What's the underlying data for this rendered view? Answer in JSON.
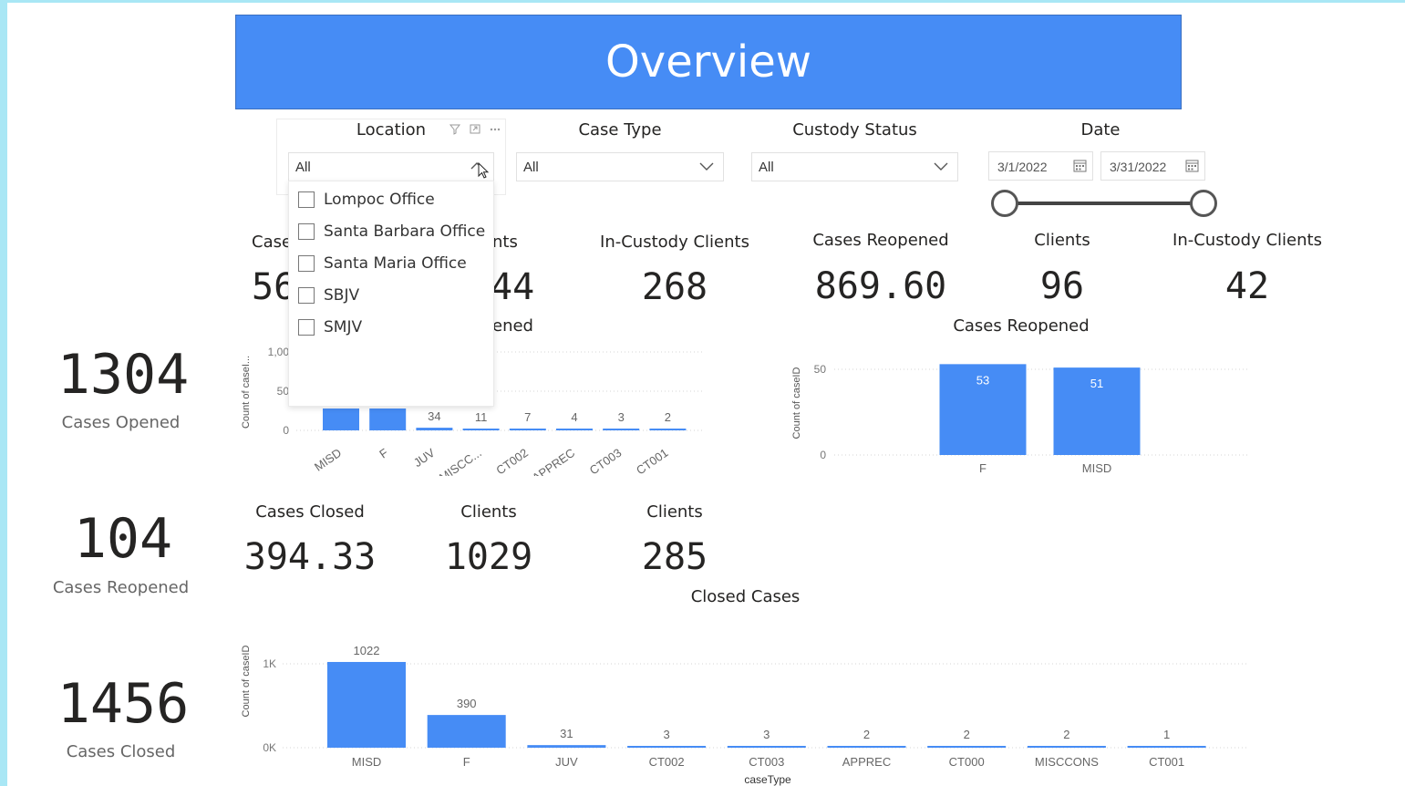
{
  "header": {
    "title": "Overview"
  },
  "slicers": {
    "location": {
      "title": "Location",
      "value": "All"
    },
    "case_type": {
      "title": "Case Type",
      "value": "All"
    },
    "custody_status": {
      "title": "Custody Status",
      "value": "All"
    },
    "date": {
      "title": "Date",
      "start": "3/1/2022",
      "end": "3/31/2022"
    }
  },
  "location_options": [
    "Lompoc Office",
    "Santa Barbara Office",
    "Santa Maria Office",
    "SBJV",
    "SMJV"
  ],
  "left_kpis": [
    {
      "value": "1304",
      "label": "Cases Opened"
    },
    {
      "value": "104",
      "label": "Cases Reopened"
    },
    {
      "value": "1456",
      "label": "Cases Closed"
    }
  ],
  "row1_kpis": {
    "cases_label_partial": "Case",
    "cases_value_partial": "56",
    "clients_label_partial": "nts",
    "clients_value_partial": "44",
    "incustody_label": "In-Custody Clients",
    "incustody_value": "268"
  },
  "row1_right_kpis": [
    {
      "label": "Cases Reopened",
      "value": "869.60"
    },
    {
      "label": "Clients",
      "value": "96"
    },
    {
      "label": "In-Custody Clients",
      "value": "42"
    }
  ],
  "row2_kpis": [
    {
      "label": "Cases Closed",
      "value": "394.33"
    },
    {
      "label": "Clients",
      "value": "1029"
    },
    {
      "label": "Clients",
      "value": "285"
    }
  ],
  "chart_titles": {
    "opened_partial": "ened",
    "reopened": "Cases Reopened",
    "closed": "Closed Cases"
  },
  "chart_data": [
    {
      "type": "bar",
      "title": "",
      "ylabel": "Count of caseI...",
      "categories": [
        "MISD",
        "F",
        "JUV",
        "MISCC...",
        "CT002",
        "APPREC",
        "CT003",
        "CT001"
      ],
      "values": [
        null,
        null,
        34,
        11,
        7,
        4,
        3,
        2
      ],
      "yticks": [
        "0",
        "50",
        "1,00"
      ],
      "ylim": [
        0,
        1000
      ],
      "color": "#468cf5"
    },
    {
      "type": "bar",
      "title": "Cases Reopened",
      "ylabel": "Count of caseID",
      "categories": [
        "F",
        "MISD"
      ],
      "values": [
        53,
        51
      ],
      "yticks": [
        "0",
        "50"
      ],
      "ylim": [
        0,
        50
      ],
      "color": "#468cf5"
    },
    {
      "type": "bar",
      "title": "Closed Cases",
      "xlabel": "caseType",
      "ylabel": "Count of caseID",
      "categories": [
        "MISD",
        "F",
        "JUV",
        "CT002",
        "CT003",
        "APPREC",
        "CT000",
        "MISCCONS",
        "CT001"
      ],
      "values": [
        1022,
        390,
        31,
        3,
        3,
        2,
        2,
        2,
        1
      ],
      "yticks": [
        "0K",
        "1K"
      ],
      "ylim": [
        0,
        1000
      ],
      "color": "#468cf5"
    }
  ]
}
